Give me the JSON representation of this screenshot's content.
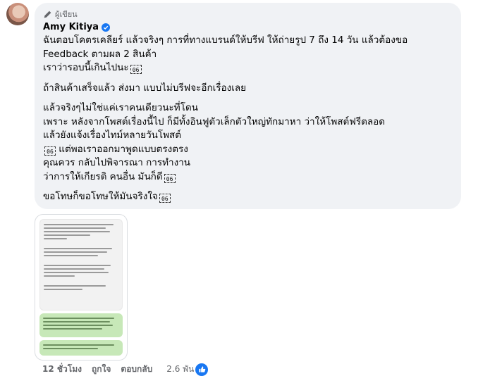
{
  "comment": {
    "badge": "ผู้เขียน",
    "author": "Amy Kitiya",
    "paragraphs": [
      [
        "ฉันตอบโคตรเคลียร์ แล้วจริงๆ การที่ทางแบรนด์ให้บรีฟ ให้ถ่ายรูป 7 ถึง 14 วัน แล้วต้องขอ",
        "Feedback ตามผล 2 สินค้า",
        "เราว่ารอบนี้เกินไปนะ"
      ],
      [
        "ถ้าสินค้าเสร็จแล้ว ส่งมา แบบไม่บรีฟจะอีกเรื่องเลย"
      ],
      [
        "แล้วจริงๆไม่ใช่แค่เราคนเดียวนะที่โดน",
        "เพราะ หลังจากโพสต์เรื่องนี้ไป ก็มีทั้งอินฟูตัวเล็กตัวใหญ่ทักมาหา ว่าให้โพสต์ฟรีตลอด",
        "แล้วยังแจ้งเรื่องไทม์หลายวันโพสต์",
        "แต่พอเราออกมาพูดแบบตรงตรง",
        "คุณควร กลับไปพิจารณา การทำงาน",
        "ว่าการให้เกียรติ คนอื่น มันก็ดี"
      ],
      [
        "ขอโทษก็ขอโทษให้มันจริงใจ"
      ]
    ],
    "emoji_glyph": "06"
  },
  "footer": {
    "time": "12 ชั่วโมง",
    "like": "ถูกใจ",
    "reply": "ตอบกลับ",
    "reactions": "2.6 พัน"
  },
  "colors": {
    "accent": "#1877f2",
    "bubble": "#f0f2f5",
    "muted": "#65676b"
  },
  "icons": [
    "pen-icon",
    "verified-icon",
    "like-reaction-icon"
  ]
}
